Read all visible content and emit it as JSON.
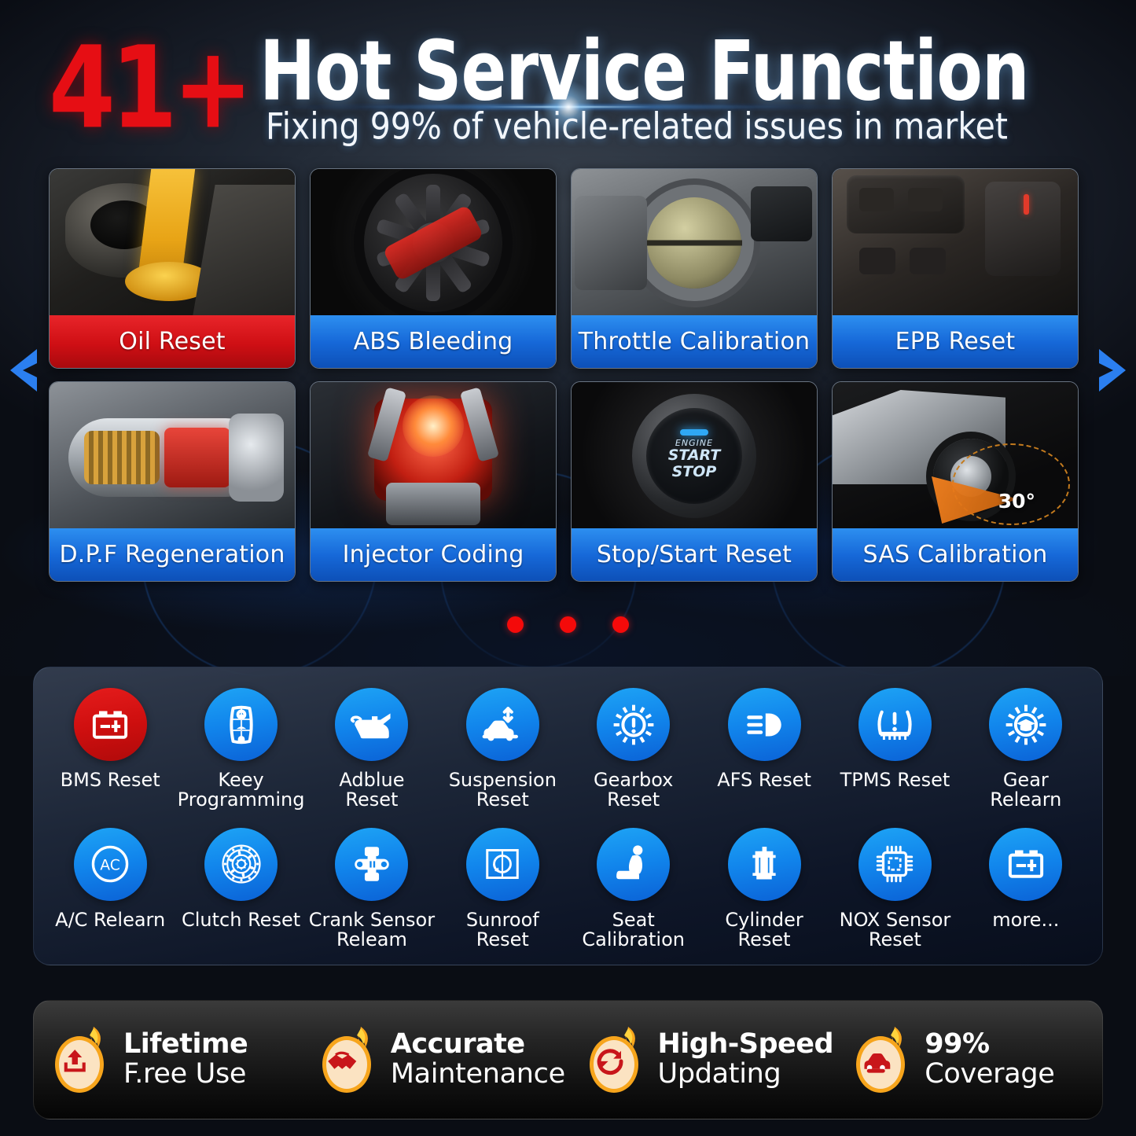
{
  "header": {
    "badge_number": "41+",
    "title": "Hot Service Function",
    "subtitle": "Fixing 99% of vehicle-related issues in market"
  },
  "carousel": {
    "prev_label": "previous",
    "next_label": "next",
    "dot_count": 3,
    "active_dot": 1,
    "cards": [
      {
        "label": "Oil Reset",
        "style": "red",
        "image": "engine-oil-pour-photo"
      },
      {
        "label": "ABS Bleeding",
        "style": "blue",
        "image": "alloy-wheel-brake-caliper-photo"
      },
      {
        "label": "Throttle Calibration",
        "style": "blue",
        "image": "throttle-body-photo"
      },
      {
        "label": "EPB Reset",
        "style": "blue",
        "image": "center-console-buttons-photo"
      },
      {
        "label": "D.P.F Regeneration",
        "style": "blue",
        "image": "diesel-particulate-filter-cutaway"
      },
      {
        "label": "Injector Coding",
        "style": "blue",
        "image": "engine-piston-combustion-glow"
      },
      {
        "label": "Stop/Start Reset",
        "style": "blue",
        "image": "engine-start-stop-button"
      },
      {
        "label": "SAS Calibration",
        "style": "blue",
        "image": "steering-angle-sensor-car-diagram"
      }
    ],
    "card_overlays": {
      "start_stop_line1": "ENGINE",
      "start_stop_line2": "START",
      "start_stop_line3": "STOP",
      "sas_angle": "30°"
    }
  },
  "functions": {
    "row1": [
      {
        "label": "BMS Reset",
        "icon": "battery-icon",
        "color": "red"
      },
      {
        "label": "Keey\nProgramming",
        "icon": "key-lock-icon",
        "color": "blue"
      },
      {
        "label": "Adblue\nReset",
        "icon": "oil-can-icon",
        "color": "blue"
      },
      {
        "label": "Suspension\nReset",
        "icon": "car-suspension-icon",
        "color": "blue"
      },
      {
        "label": "Gearbox\nReset",
        "icon": "gear-warning-icon",
        "color": "blue"
      },
      {
        "label": "AFS Reset",
        "icon": "headlight-icon",
        "color": "blue"
      },
      {
        "label": "TPMS Reset",
        "icon": "tire-pressure-icon",
        "color": "blue"
      },
      {
        "label": "Gear\nRelearn",
        "icon": "gear-graduation-icon",
        "color": "blue"
      }
    ],
    "row2": [
      {
        "label": "A/C Relearn",
        "icon": "ac-circle-icon",
        "color": "blue"
      },
      {
        "label": "Clutch Reset",
        "icon": "clutch-disc-icon",
        "color": "blue"
      },
      {
        "label": "Crank Sensor\nReleam",
        "icon": "crank-sensor-icon",
        "color": "blue"
      },
      {
        "label": "Sunroof\nReset",
        "icon": "sunroof-icon",
        "color": "blue"
      },
      {
        "label": "Seat\nCalibration",
        "icon": "car-seat-icon",
        "color": "blue"
      },
      {
        "label": "Cylinder\nReset",
        "icon": "cylinder-icon",
        "color": "blue"
      },
      {
        "label": "NOX Sensor\nReset",
        "icon": "chip-sensor-icon",
        "color": "blue"
      },
      {
        "label": "more...",
        "icon": "battery-icon",
        "color": "blue"
      }
    ],
    "ac_icon_text": "AC"
  },
  "features": [
    {
      "top": "Lifetime",
      "bottom": "F.ree Use",
      "icon": "upload-box-icon"
    },
    {
      "top": "Accurate",
      "bottom": "Maintenance",
      "icon": "handshake-icon"
    },
    {
      "top": "High-Speed",
      "bottom": "Updating",
      "icon": "refresh-cycle-icon"
    },
    {
      "top": "99%",
      "bottom": "Coverage",
      "icon": "car-front-icon"
    }
  ],
  "colors": {
    "accent_blue": "#1185ec",
    "accent_red": "#cf0f14",
    "flame_orange": "#f9a01b",
    "panel_dark": "#121a2c"
  }
}
